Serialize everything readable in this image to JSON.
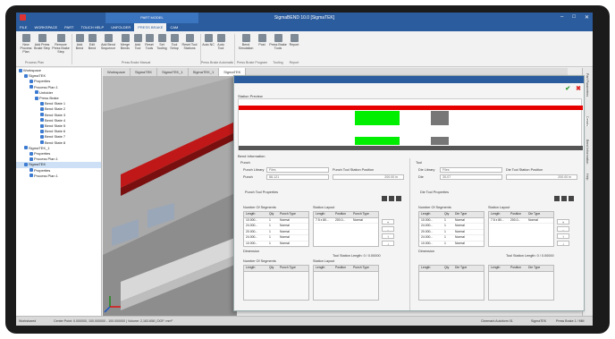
{
  "window": {
    "title": "SigmaBEND 10.0 [SigmaTEK]",
    "context_tab": "PART MODEL",
    "controls": [
      "–",
      "□",
      "✕"
    ]
  },
  "ribbon_tabs": [
    "FILE",
    "WORKSPACE",
    "PART",
    "TOUCH HELP",
    "UNFOLDER",
    "PRESS BRAKE",
    "CAM"
  ],
  "ribbon_buttons": [
    {
      "label": "New Process Plan"
    },
    {
      "label": "Add Press Brake Step"
    },
    {
      "label": "Remove Press Brake Step"
    },
    {
      "label": "Add Bend"
    },
    {
      "label": "Edit Bend"
    },
    {
      "label": "Add Bend Sequence"
    },
    {
      "label": "Merge Bends"
    },
    {
      "label": "Add Tool"
    },
    {
      "label": "Reset Tools"
    },
    {
      "label": "Set Tooling"
    },
    {
      "label": "Tool Setup"
    },
    {
      "label": "Reset Tool Stations"
    },
    {
      "label": "Auto NC"
    },
    {
      "label": "Auto Tool"
    },
    {
      "label": "Bend Simulation"
    },
    {
      "label": "Post"
    },
    {
      "label": "Press Brake Tools"
    },
    {
      "label": "Report"
    }
  ],
  "ribbon_groups": [
    "Process Plan",
    "Press Brake Manual",
    "Press Brake Automatic",
    "Press Brake Program",
    "Tooling",
    "Report"
  ],
  "tree": {
    "items": [
      {
        "label": "Workspace",
        "indent": 0
      },
      {
        "label": "SigmaTEK",
        "indent": 1
      },
      {
        "label": "Properties",
        "indent": 2
      },
      {
        "label": "Process Plan 1",
        "indent": 2
      },
      {
        "label": "Unfolder",
        "indent": 3
      },
      {
        "label": "Press Brake",
        "indent": 3
      },
      {
        "label": "Bend State 1",
        "indent": 4
      },
      {
        "label": "Bend State 2",
        "indent": 4
      },
      {
        "label": "Bend State 3",
        "indent": 4
      },
      {
        "label": "Bend State 4",
        "indent": 4
      },
      {
        "label": "Bend State 5",
        "indent": 4
      },
      {
        "label": "Bend State 6",
        "indent": 4
      },
      {
        "label": "Bend State 7",
        "indent": 4
      },
      {
        "label": "Bend State 8",
        "indent": 4
      },
      {
        "label": "SigmaTEK_1",
        "indent": 1
      },
      {
        "label": "Properties",
        "indent": 2
      },
      {
        "label": "Process Plan 1",
        "indent": 2
      },
      {
        "label": "SigmaTEK",
        "indent": 1,
        "selected": true
      },
      {
        "label": "Properties",
        "indent": 2
      },
      {
        "label": "Process Plan 1",
        "indent": 2
      }
    ]
  },
  "view_tabs": [
    "Workspace",
    "SigmaTEK",
    "SigmaTEK_1",
    "SigmaTEK_1",
    "SigmaTEK"
  ],
  "right_rail": [
    "Part Parameters",
    "Details",
    "Bend Information",
    "Help"
  ],
  "dialog": {
    "preview_label": "Station Preview",
    "section_label": "Bend Information",
    "punch": {
      "label": "Punch",
      "library_label": "Punch Library",
      "library_value": "Files",
      "station_label": "Punch Tool Station Position",
      "station_value": "200.00 in",
      "punch_label": "Punch",
      "punch_value": "88-121",
      "props_label": "Punch Tool Properties",
      "segments_label": "Number Of Segments",
      "layout_label": "Station Layout",
      "seg_headers": [
        "Length",
        "Qty",
        "Punch Type"
      ],
      "seg_rows": [
        [
          "10.000...",
          "1",
          "Normal"
        ],
        [
          "24.000...",
          "1",
          "Normal"
        ],
        [
          "20.000...",
          "1",
          "Normal"
        ],
        [
          "24.000...",
          "1",
          "Normal"
        ],
        [
          "10.000...",
          "1",
          "Normal"
        ]
      ],
      "layout_headers": [
        "Length",
        "Position",
        "Punch Type"
      ],
      "layout_rows": [
        [
          "7.5 x 80...",
          "200.0...",
          "Normal"
        ]
      ],
      "dimension_label": "Dimension",
      "station_length": "Tool Station Length: 0 / 0.00000",
      "seg2_label": "Number Of Segments",
      "layout2_label": "Station Layout",
      "seg2_headers": [
        "Length",
        "Qty",
        "Punch Type"
      ],
      "layout2_headers": [
        "Length",
        "Position",
        "Punch Type"
      ]
    },
    "die": {
      "label": "Tool",
      "library_label": "Die Library",
      "library_value": "Files",
      "station_label": "Die Tool Station Position",
      "station_value": "200.00 in",
      "die_label": "Die",
      "die_value": "30-07",
      "props_label": "Die Tool Properties",
      "segments_label": "Number Of Segments",
      "layout_label": "Station Layout",
      "seg_headers": [
        "Length",
        "Qty",
        "Die Type"
      ],
      "seg_rows": [
        [
          "10.000...",
          "1",
          "Normal"
        ],
        [
          "24.000...",
          "1",
          "Normal"
        ],
        [
          "20.000...",
          "1",
          "Normal"
        ],
        [
          "24.000...",
          "1",
          "Normal"
        ],
        [
          "10.000...",
          "1",
          "Normal"
        ]
      ],
      "layout_headers": [
        "Length",
        "Position",
        "Die Type"
      ],
      "layout_rows": [
        [
          "7.5 x 80...",
          "200.0...",
          "Normal"
        ]
      ],
      "dimension_label": "Dimension",
      "station_length": "Tool Station Length: 0 / 0.00000",
      "seg2_headers": [
        "Length",
        "Qty",
        "Die Type"
      ],
      "layout2_headers": [
        "Length",
        "Position",
        "Die Type"
      ]
    },
    "side_buttons": [
      "+",
      "-",
      "↑",
      "↓"
    ]
  },
  "status": {
    "left": "Workshared",
    "center": "Center Point: 0.000000, 100.000000 - 100.000000 | Volume: 2,163.658 | DOF: mm³",
    "right1": "Cinemark Autoform 01",
    "right2": "SigmaTEK",
    "right3": "Press Brake 1 / MM"
  },
  "colors": {
    "accent": "#2b5c9e",
    "preview_red": "#e60000",
    "preview_green": "#00ee00",
    "preview_gray": "#777777",
    "viewport_red": "#c01818"
  }
}
